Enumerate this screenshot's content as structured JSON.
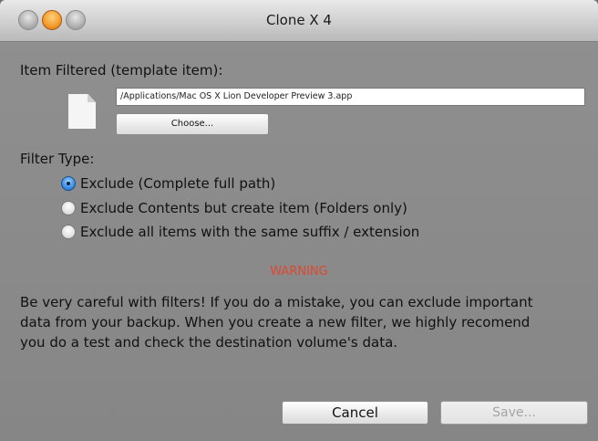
{
  "window": {
    "title": "Clone X 4"
  },
  "item_filtered": {
    "label": "Item Filtered (template item):",
    "path_value": "/Applications/Mac OS X Lion Developer Preview 3.app",
    "choose_label": "Choose..."
  },
  "filter_type": {
    "label": "Filter Type:",
    "options": [
      {
        "label": "Exclude (Complete full path)",
        "selected": true
      },
      {
        "label": "Exclude Contents but create item (Folders only)",
        "selected": false
      },
      {
        "label": "Exclude all items with the same suffix / extension",
        "selected": false
      }
    ]
  },
  "warning": {
    "title": "WARNING",
    "lines": [
      "Be very careful with filters! If you do a mistake, you can exclude important",
      "data from your backup. When you create a new filter, we highly recomend",
      "you do a test and check the destination volume's data."
    ]
  },
  "buttons": {
    "cancel_label": "Cancel",
    "save_label": "Save..."
  },
  "colors": {
    "warning": "#e0462f",
    "window_bg": "#8f8f8f"
  }
}
